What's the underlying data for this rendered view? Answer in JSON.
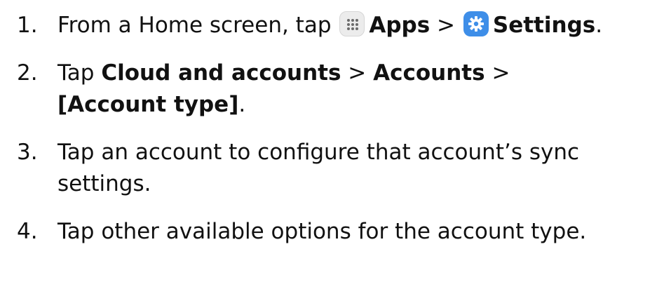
{
  "steps": [
    {
      "number": "1.",
      "parts": {
        "t1": "From a Home screen, tap",
        "apps": "Apps",
        "sep1": ">",
        "settings": "Settings",
        "end": "."
      },
      "icons": [
        "apps-icon",
        "settings-icon"
      ]
    },
    {
      "number": "2.",
      "parts": {
        "t1": "Tap",
        "cloud": "Cloud and accounts",
        "sep1": ">",
        "accounts": "Accounts",
        "sep2": ">",
        "type": "[Account type]",
        "end": "."
      }
    },
    {
      "number": "3.",
      "lines": [
        "Tap an account to configure that account’s sync",
        "settings."
      ]
    },
    {
      "number": "4.",
      "lines": [
        "Tap other available options for the account type."
      ]
    }
  ]
}
